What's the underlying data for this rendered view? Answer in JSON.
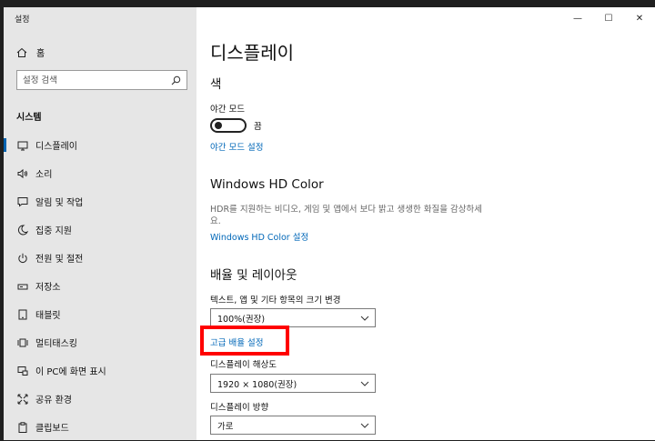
{
  "app": {
    "title": "설정"
  },
  "window_controls": {
    "minimize": "—",
    "maximize": "☐",
    "close": "✕"
  },
  "sidebar": {
    "home": "홈",
    "search_placeholder": "설정 검색",
    "section": "시스템",
    "items": [
      {
        "label": "디스플레이",
        "icon": "monitor-icon",
        "active": true
      },
      {
        "label": "소리",
        "icon": "speaker-icon"
      },
      {
        "label": "알림 및 작업",
        "icon": "notification-icon"
      },
      {
        "label": "집중 지원",
        "icon": "moon-icon"
      },
      {
        "label": "전원 및 절전",
        "icon": "power-icon"
      },
      {
        "label": "저장소",
        "icon": "storage-icon"
      },
      {
        "label": "태블릿",
        "icon": "tablet-icon"
      },
      {
        "label": "멀티태스킹",
        "icon": "multitasking-icon"
      },
      {
        "label": "이 PC에 화면 표시",
        "icon": "project-icon"
      },
      {
        "label": "공유 환경",
        "icon": "share-icon"
      },
      {
        "label": "클립보드",
        "icon": "clipboard-icon"
      }
    ]
  },
  "main": {
    "title": "디스플레이",
    "color": {
      "heading": "색",
      "night_light_label": "야간 모드",
      "night_light_state": "끔",
      "night_light_link": "야간 모드 설정"
    },
    "hdr": {
      "heading": "Windows HD Color",
      "description": "HDR를 지원하는 비디오, 게임 및 앱에서 보다 밝고 생생한 화질을 감상하세요.",
      "link": "Windows HD Color 설정"
    },
    "layout": {
      "heading": "배율 및 레이아웃",
      "scale_label": "텍스트, 앱 및 기타 항목의 크기 변경",
      "scale_value": "100%(권장)",
      "advanced_link": "고급 배율 설정",
      "resolution_label": "디스플레이 해상도",
      "resolution_value": "1920 × 1080(권장)",
      "orientation_label": "디스플레이 방향",
      "orientation_value": "가로"
    }
  }
}
